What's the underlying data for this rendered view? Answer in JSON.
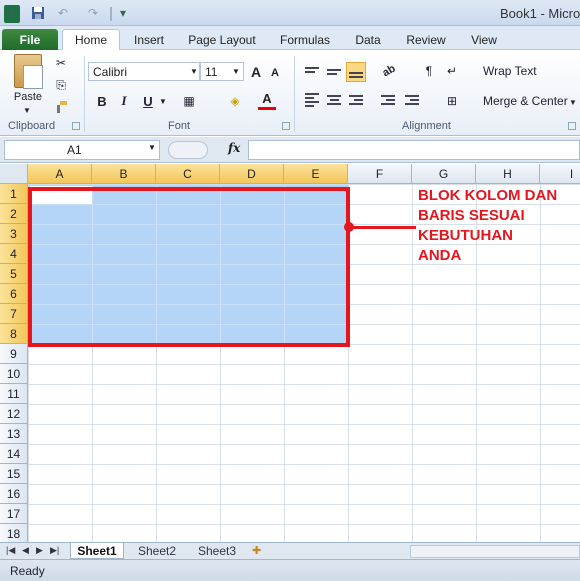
{
  "window": {
    "title": "Book1 - Micro"
  },
  "quick_access": {
    "app_icon": "X",
    "save_icon": "floppy-icon",
    "undo_icon": "↶",
    "redo_icon": "↷",
    "more_icon": "▾"
  },
  "tabs": [
    {
      "label": "File"
    },
    {
      "label": "Home"
    },
    {
      "label": "Insert"
    },
    {
      "label": "Page Layout"
    },
    {
      "label": "Formulas"
    },
    {
      "label": "Data"
    },
    {
      "label": "Review"
    },
    {
      "label": "View"
    }
  ],
  "ribbon": {
    "clipboard": {
      "group_label": "Clipboard",
      "paste_label": "Paste",
      "cut_icon": "✂",
      "copy_icon": "⎘",
      "painter_icon": "🖌"
    },
    "font": {
      "group_label": "Font",
      "font_name": "Calibri",
      "font_size": "11",
      "grow": "A",
      "shrink": "A",
      "bold": "B",
      "italic": "I",
      "underline": "U",
      "border_icon": "▦",
      "fill_icon": "◈",
      "color_icon": "A"
    },
    "alignment": {
      "group_label": "Alignment",
      "wrap_text": "Wrap Text",
      "merge_center": "Merge & Center"
    }
  },
  "formula_bar": {
    "name_box": "A1",
    "fx": "fx",
    "formula": ""
  },
  "grid": {
    "columns": [
      "A",
      "B",
      "C",
      "D",
      "E",
      "F",
      "G",
      "H",
      "I"
    ],
    "rows": [
      "1",
      "2",
      "3",
      "4",
      "5",
      "6",
      "7",
      "8",
      "9",
      "10",
      "11",
      "12",
      "13",
      "14",
      "15",
      "16",
      "17",
      "18"
    ],
    "selected_columns": [
      "A",
      "B",
      "C",
      "D",
      "E"
    ],
    "selected_rows": [
      "1",
      "2",
      "3",
      "4",
      "5",
      "6",
      "7",
      "8"
    ],
    "selection_range": "A1:E8"
  },
  "annotation": {
    "lines": [
      "BLOK KOLOM DAN",
      "BARIS SESUAI",
      "KEBUTUHAN",
      "ANDA"
    ],
    "color": "#e5161e"
  },
  "sheets": [
    {
      "label": "Sheet1",
      "active": true
    },
    {
      "label": "Sheet2"
    },
    {
      "label": "Sheet3"
    }
  ],
  "status": {
    "text": "Ready"
  },
  "colors": {
    "selection": "#b4d5f7",
    "header_selected": "#f4c65a",
    "file_tab": "#2a7a35"
  }
}
